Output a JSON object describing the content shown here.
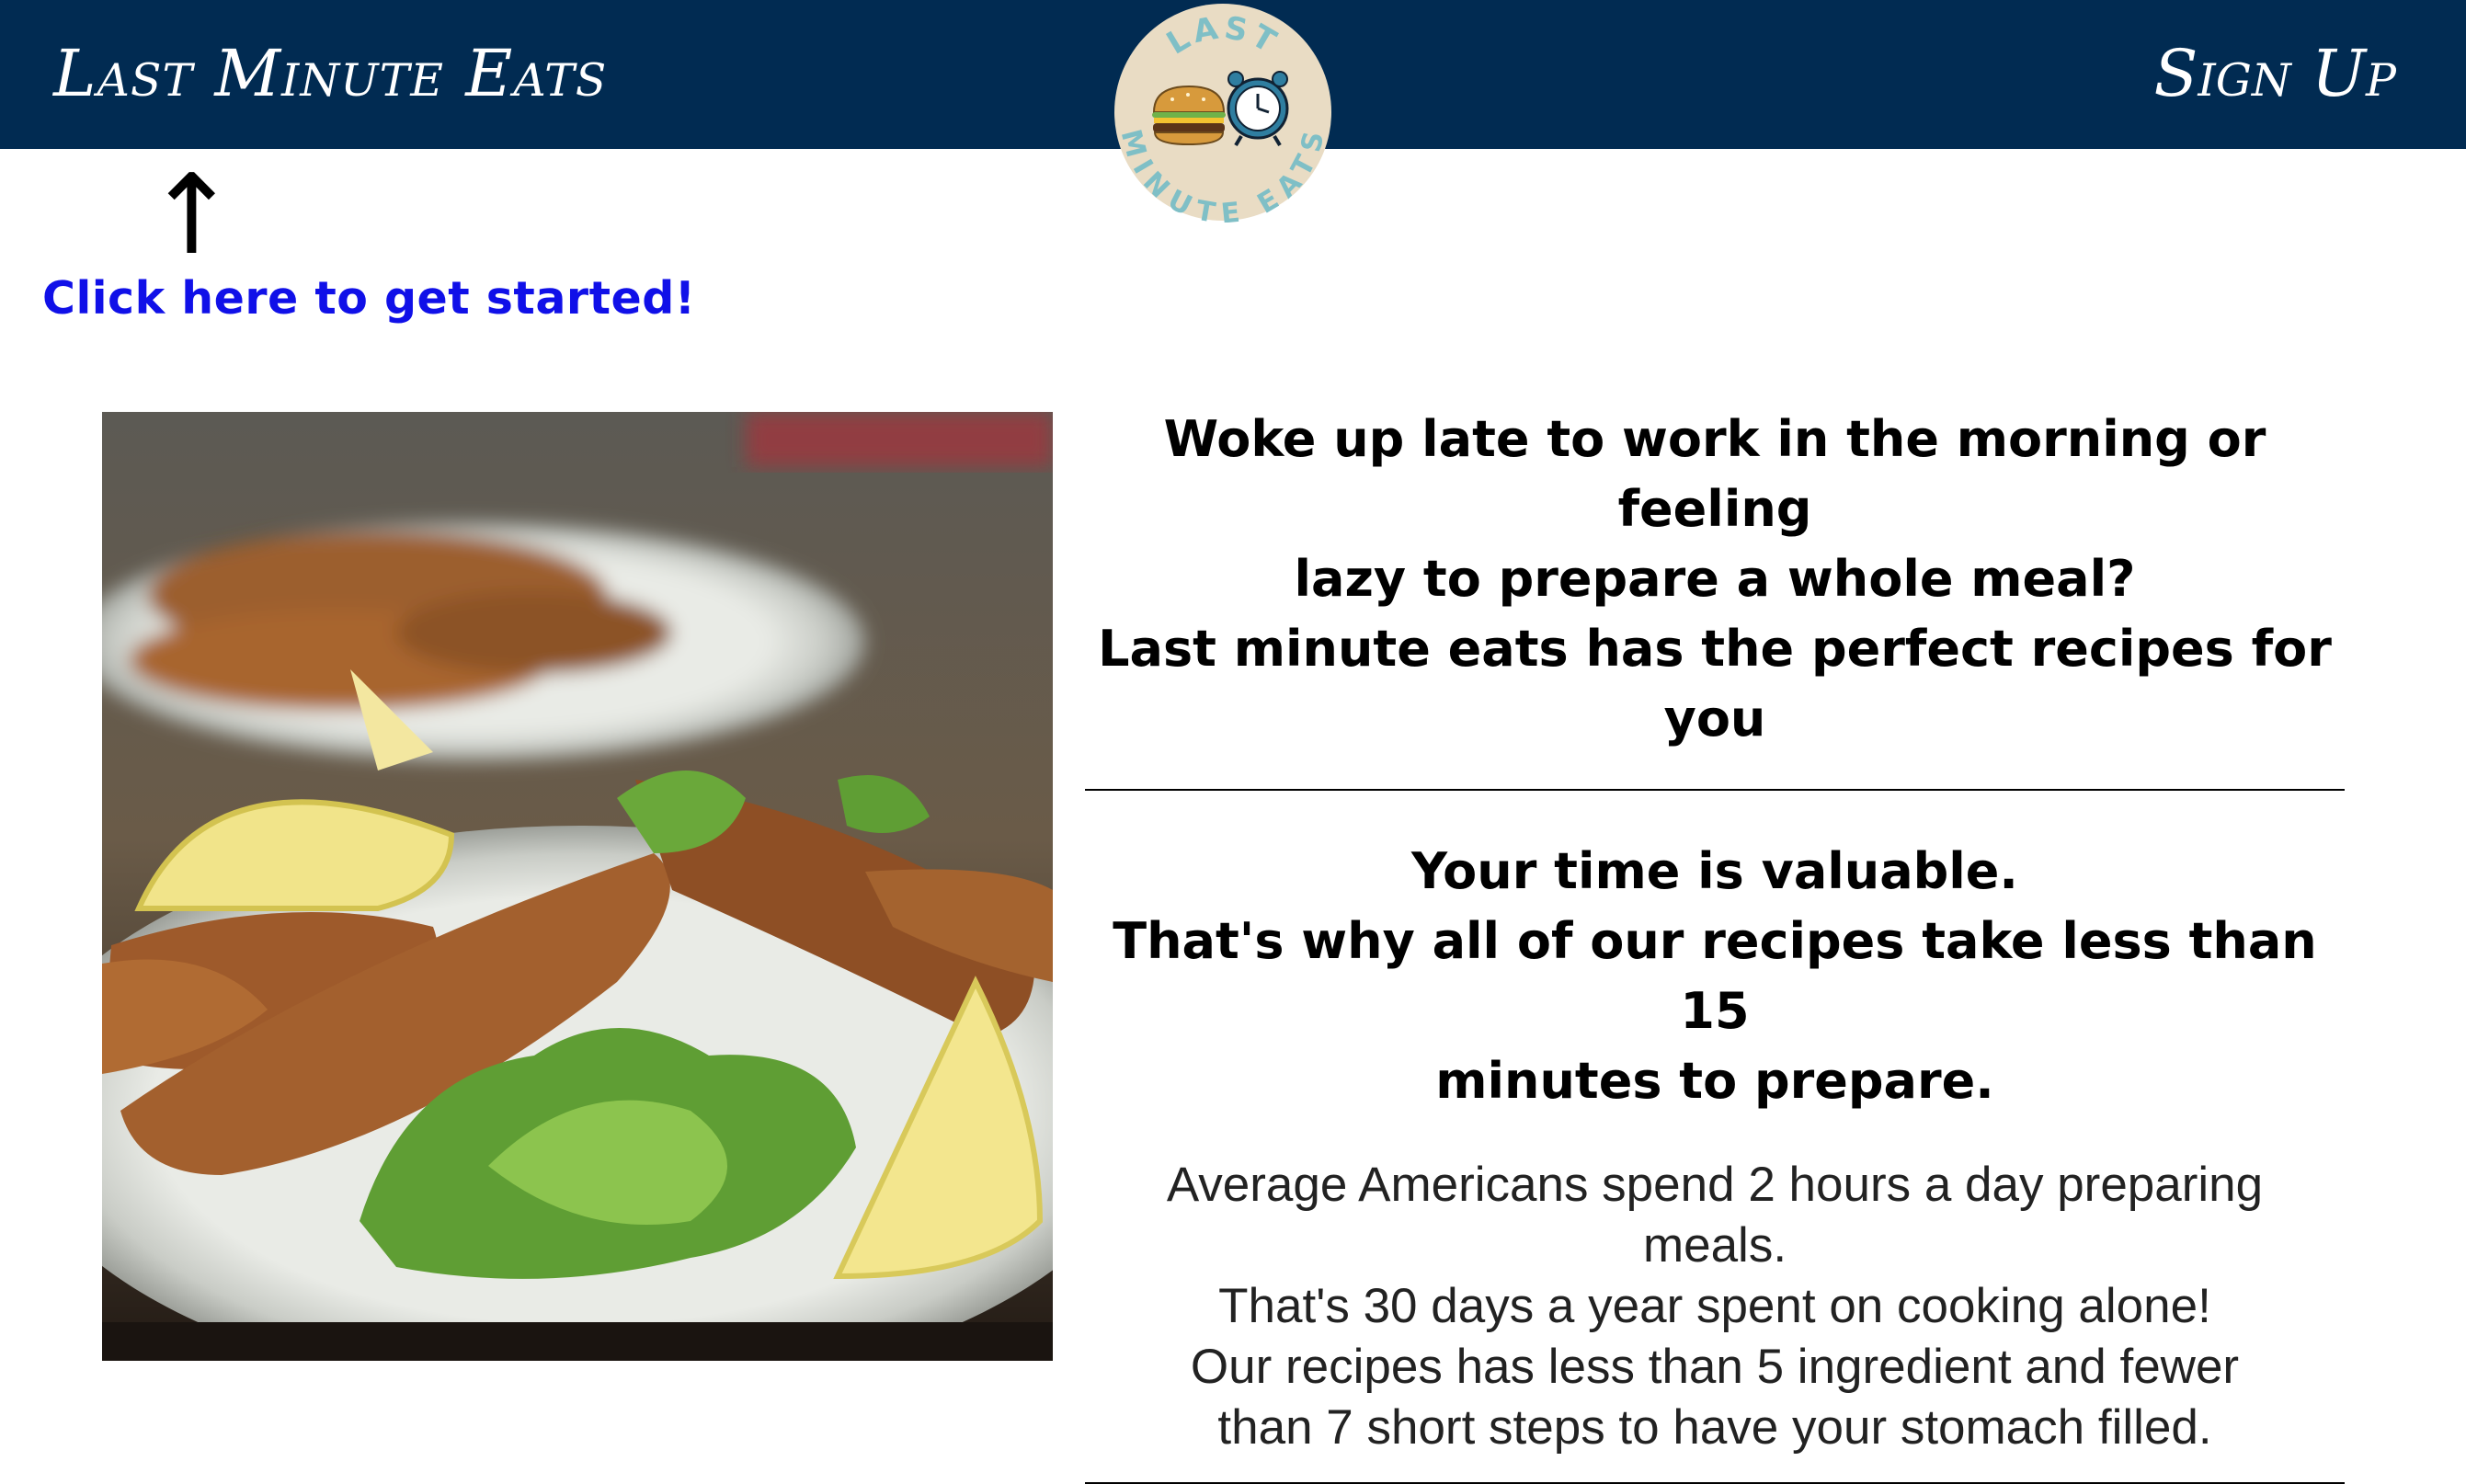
{
  "header": {
    "brand": "Last Minute Eats",
    "signup": "Sign Up",
    "logo": {
      "top_text": "LAST",
      "bottom_text": "MINUTE EATS"
    }
  },
  "hint": {
    "arrow": "↑",
    "cta": "Click here to get started!"
  },
  "main": {
    "intro_lines": [
      "Woke up late to work in the morning or feeling",
      "lazy to prepare a whole meal?",
      "Last minute eats has the perfect recipes for you"
    ],
    "headline_lines": [
      "Your time is valuable.",
      "That's why all of our recipes take less than 15",
      "minutes to prepare."
    ],
    "fact_lines": [
      "Average Americans spend 2 hours a day preparing",
      "meals.",
      "That's 30 days a year spent on cooking alone!",
      "Our recipes has less than 5 ingredient and fewer",
      "than 7 short steps to have your stomach filled."
    ]
  },
  "colors": {
    "navbar": "#012b52",
    "cta": "#1010e8",
    "logo_badge": "#e9dcc4",
    "logo_text": "#7fbfc6"
  }
}
